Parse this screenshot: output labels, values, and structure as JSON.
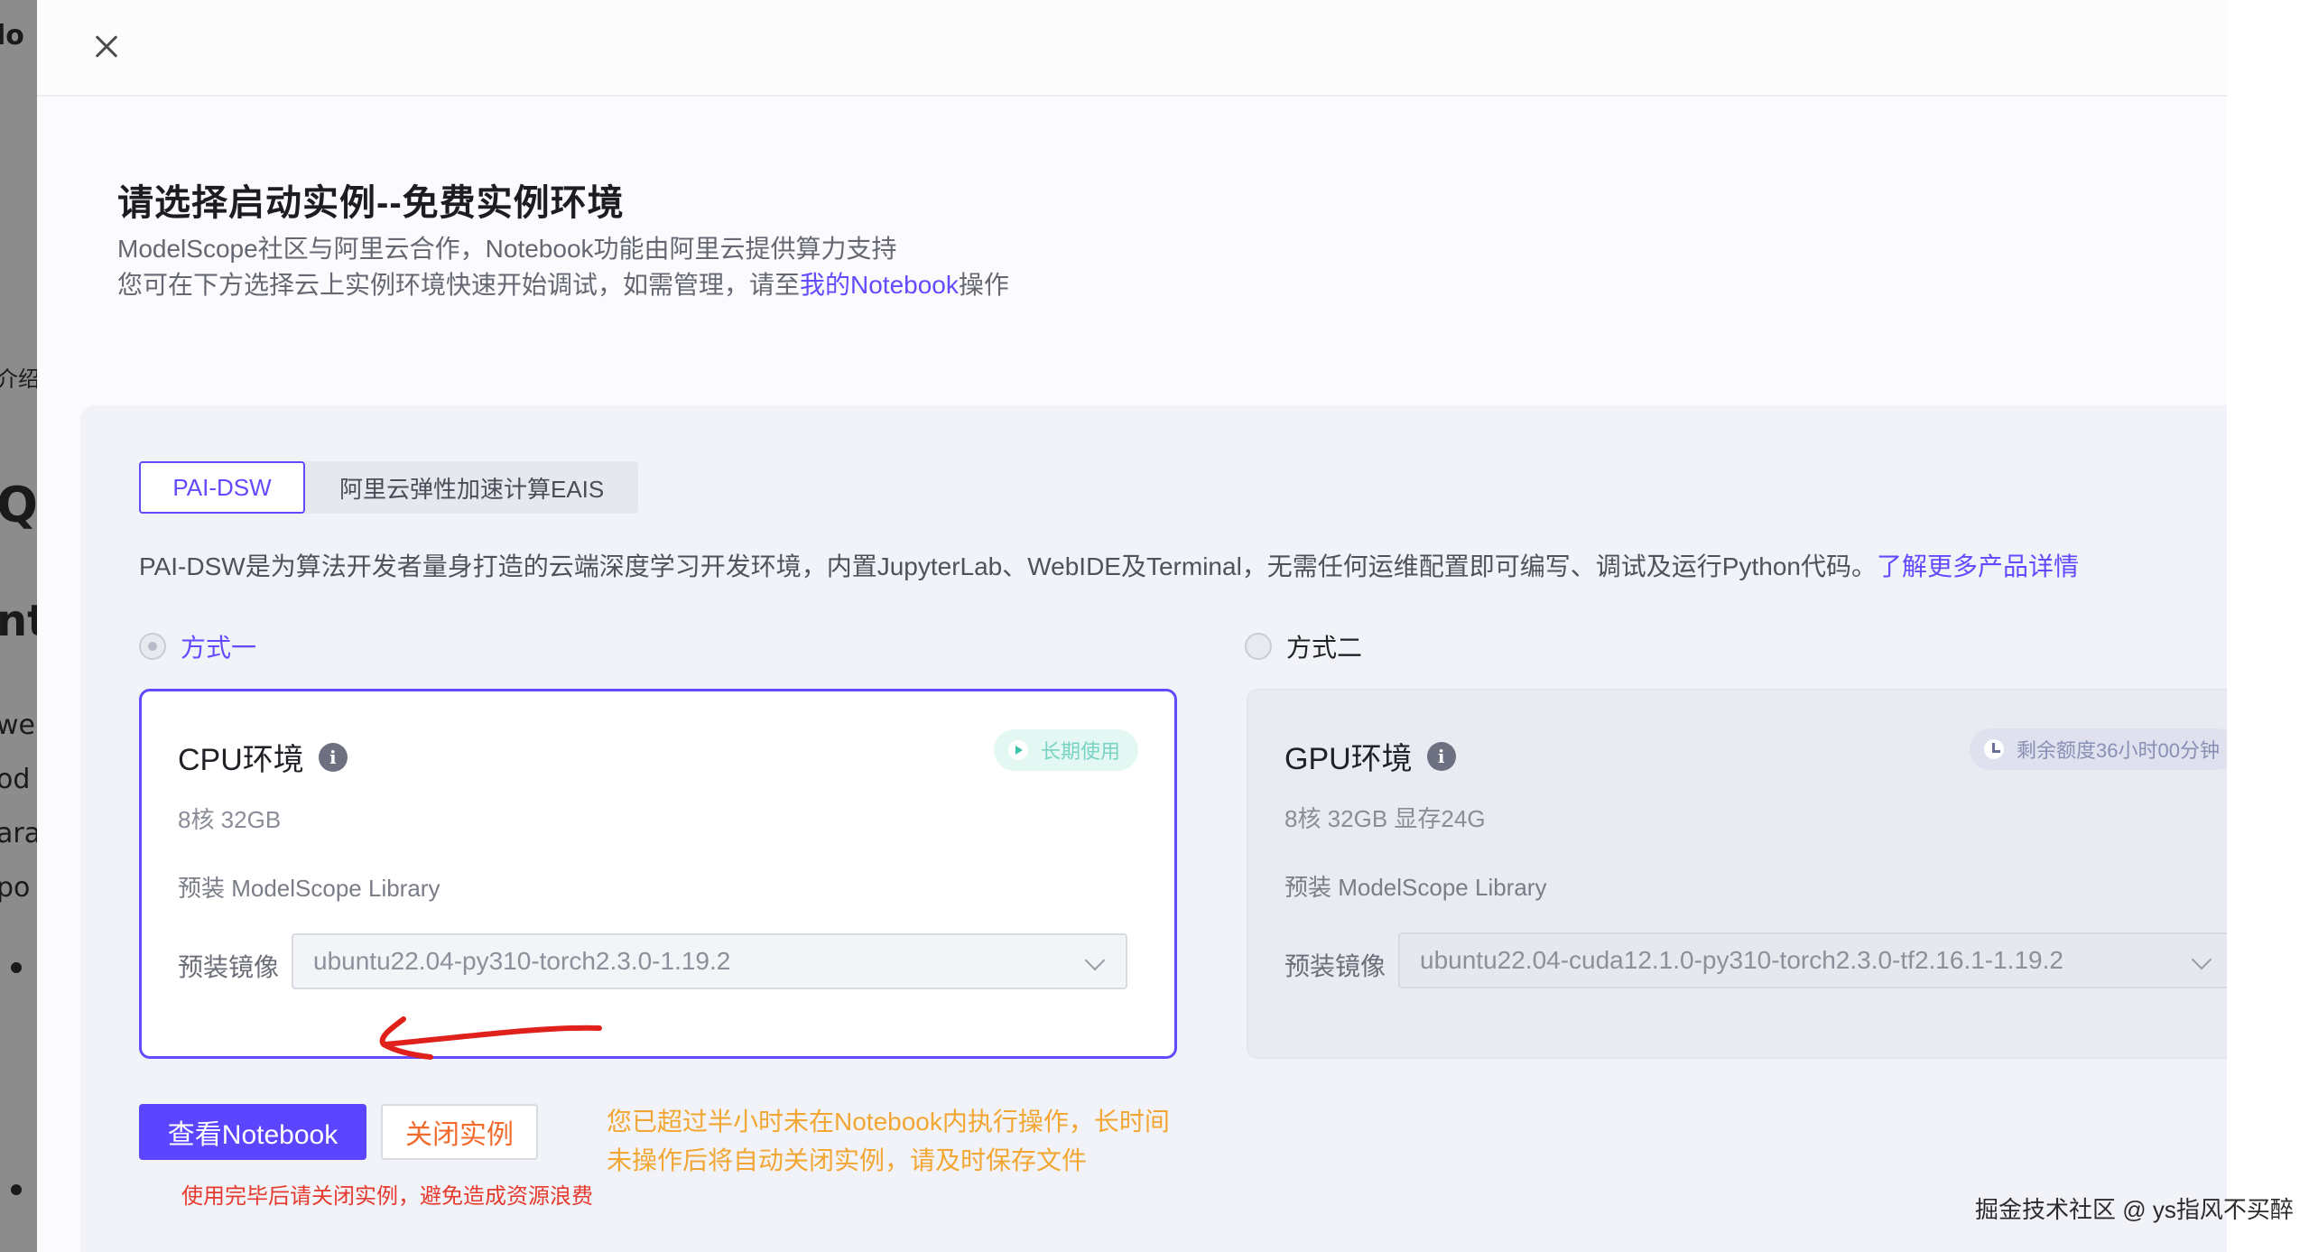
{
  "background_page": {
    "fragments": [
      "lo",
      "⋮",
      "介绍",
      "Qw",
      "nt",
      "we",
      "od",
      "ara",
      "po"
    ]
  },
  "drawer": {
    "title": "请选择启动实例--免费实例环境",
    "subtitle_line1": "ModelScope社区与阿里云合作，Notebook功能由阿里云提供算力支持",
    "subtitle_line2_prefix": "您可在下方选择云上实例环境快速开始调试，如需管理，请至",
    "subtitle_line2_link": "我的Notebook",
    "subtitle_line2_suffix": "操作"
  },
  "tabs": [
    {
      "label": "PAI-DSW",
      "active": true
    },
    {
      "label": "阿里云弹性加速计算EAIS",
      "active": false
    }
  ],
  "description": {
    "text": "PAI-DSW是为算法开发者量身打造的云端深度学习开发环境，内置JupyterLab、WebIDE及Terminal，无需任何运维配置即可编写、调试及运行Python代码。",
    "link": "了解更多产品详情"
  },
  "options": [
    {
      "label": "方式一",
      "checked": true
    },
    {
      "label": "方式二",
      "checked": false
    }
  ],
  "cpu_env": {
    "title": "CPU环境",
    "badge": "长期使用",
    "spec": "8核 32GB",
    "library": "预装 ModelScope Library",
    "image_label": "预装镜像",
    "image_value": "ubuntu22.04-py310-torch2.3.0-1.19.2"
  },
  "gpu_env": {
    "title": "GPU环境",
    "badge": "剩余额度36小时00分钟",
    "spec": "8核 32GB 显存24G",
    "library": "预装 ModelScope Library",
    "image_label": "预装镜像",
    "image_value": "ubuntu22.04-cuda12.1.0-py310-torch2.3.0-tf2.16.1-1.19.2"
  },
  "actions": {
    "view_notebook": "查看Notebook",
    "close_instance": "关闭实例",
    "warning": "您已超过半小时未在Notebook内执行操作，长时间未操作后将自动关闭实例，请及时保存文件",
    "hint": "使用完毕后请关闭实例，避免造成资源浪费"
  },
  "watermark": "掘金技术社区 @ ys指风不买醉",
  "colors": {
    "accent": "#624aff",
    "primary_button": "#5b45ff",
    "warning": "#f2a633",
    "danger": "#e53a2e",
    "annotation_arrow": "#e0201a"
  }
}
